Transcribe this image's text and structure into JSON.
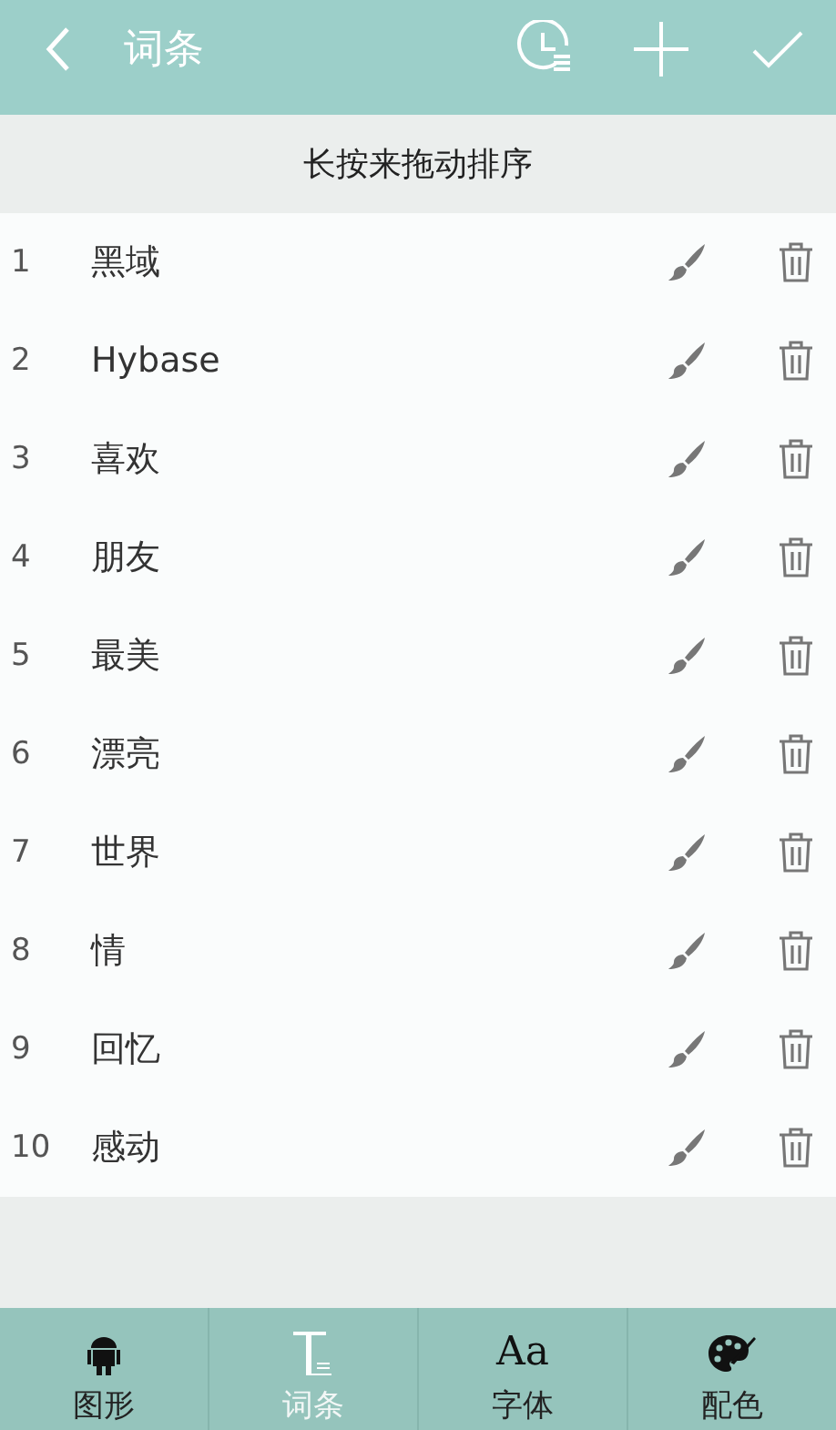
{
  "header": {
    "title": "词条"
  },
  "hint": "长按来拖动排序",
  "entries": [
    {
      "index": "1",
      "word": "黑域"
    },
    {
      "index": "2",
      "word": "Hybase"
    },
    {
      "index": "3",
      "word": "喜欢"
    },
    {
      "index": "4",
      "word": "朋友"
    },
    {
      "index": "5",
      "word": "最美"
    },
    {
      "index": "6",
      "word": "漂亮"
    },
    {
      "index": "7",
      "word": "世界"
    },
    {
      "index": "8",
      "word": "情"
    },
    {
      "index": "9",
      "word": "回忆"
    },
    {
      "index": "10",
      "word": "感动"
    }
  ],
  "tabs": [
    {
      "kind": "android",
      "label": "图形",
      "selected": false
    },
    {
      "kind": "text",
      "label": "词条",
      "selected": true
    },
    {
      "kind": "font",
      "glyph": "Aa",
      "label": "字体",
      "selected": false
    },
    {
      "kind": "palette",
      "label": "配色",
      "selected": false
    }
  ]
}
